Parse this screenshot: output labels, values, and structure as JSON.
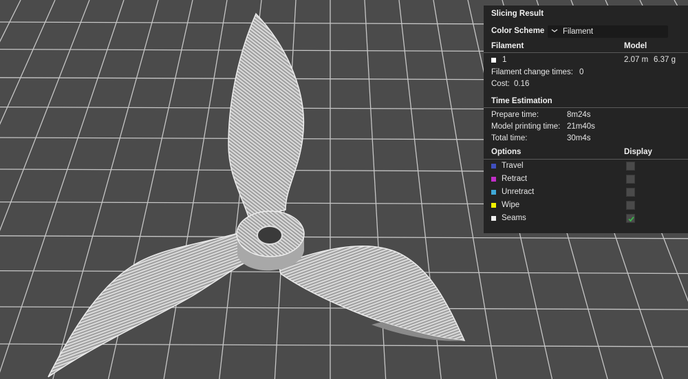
{
  "panel": {
    "title": "Slicing Result",
    "color_scheme": {
      "label": "Color Scheme",
      "value": "Filament"
    },
    "filament_header": "Filament",
    "model_header": "Model",
    "filament_row": {
      "index": "1",
      "length": "2.07 m",
      "weight": "6.37 g",
      "color": "#ffffff"
    },
    "filament_change": {
      "label": "Filament change times:",
      "value": "0"
    },
    "cost": {
      "label": "Cost:",
      "value": "0.16"
    },
    "time_estimation": {
      "title": "Time Estimation",
      "rows": [
        {
          "label": "Prepare time:",
          "value": "8m24s"
        },
        {
          "label": "Model printing time:",
          "value": "21m40s"
        },
        {
          "label": "Total time:",
          "value": "30m4s"
        }
      ]
    },
    "options_header": "Options",
    "display_header": "Display",
    "options": [
      {
        "label": "Travel",
        "color": "#3f4fbf",
        "checked": false
      },
      {
        "label": "Retract",
        "color": "#c02ec8",
        "checked": false
      },
      {
        "label": "Unretract",
        "color": "#3fa8d6",
        "checked": false
      },
      {
        "label": "Wipe",
        "color": "#f2f200",
        "checked": false
      },
      {
        "label": "Seams",
        "color": "#eeeeee",
        "checked": true
      }
    ],
    "check_color": "#3bb54a"
  },
  "viewport": {
    "background": "#4b4b4b",
    "grid_color": "#dcdcdc",
    "model_color": "#c8c8c8"
  }
}
